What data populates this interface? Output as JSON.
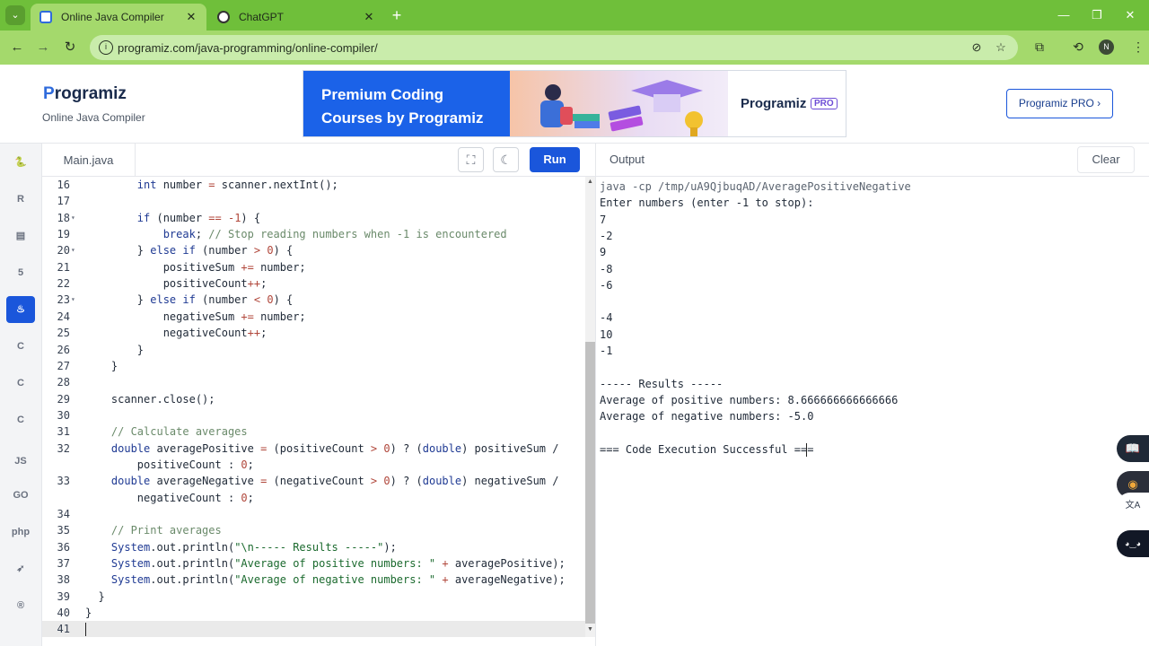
{
  "browser": {
    "tabs": [
      {
        "label": "Online Java Compiler",
        "active": true
      },
      {
        "label": "ChatGPT",
        "active": false
      }
    ],
    "tab_close": "✕",
    "new_tab": "+",
    "url": "programiz.com/java-programming/online-compiler/",
    "profile_initial": "N",
    "window_controls": {
      "minimize": "—",
      "maximize": "❐",
      "close": "✕"
    },
    "nav": {
      "back": "←",
      "forward": "→",
      "reload": "↻"
    }
  },
  "header": {
    "logo_mark": "P",
    "logo_text": "rogramiz",
    "subtitle": "Online Java Compiler",
    "banner": {
      "headline_1": "Premium Coding",
      "headline_2": "Courses by Programiz",
      "brand": "Programiz",
      "badge": "PRO"
    },
    "pro_button": "Programiz PRO ›"
  },
  "rail": [
    {
      "name": "python-icon",
      "glyph": "🐍",
      "active": false
    },
    {
      "name": "r-icon",
      "glyph": "R",
      "active": false
    },
    {
      "name": "sql-icon",
      "glyph": "▤",
      "active": false
    },
    {
      "name": "html-icon",
      "glyph": "5",
      "active": false
    },
    {
      "name": "java-icon",
      "glyph": "♨",
      "active": true
    },
    {
      "name": "c-icon",
      "glyph": "C",
      "active": false
    },
    {
      "name": "cpp-icon",
      "glyph": "C",
      "active": false
    },
    {
      "name": "csharp-icon",
      "glyph": "C",
      "active": false
    },
    {
      "name": "js-icon",
      "glyph": "JS",
      "active": false
    },
    {
      "name": "go-icon",
      "glyph": "GO",
      "active": false
    },
    {
      "name": "php-icon",
      "glyph": "php",
      "active": false
    },
    {
      "name": "swift-icon",
      "glyph": "➶",
      "active": false
    },
    {
      "name": "rust-icon",
      "glyph": "®",
      "active": false
    }
  ],
  "editor": {
    "file_tab": "Main.java",
    "run_label": "Run",
    "fullscreen_glyph": "⛶",
    "theme_glyph": "☾"
  },
  "code": [
    {
      "n": "16",
      "fold": false,
      "segs": [
        [
          "",
          "        "
        ],
        [
          "kw",
          "int"
        ],
        [
          "",
          " number "
        ],
        [
          "op",
          "="
        ],
        [
          "",
          " scanner.nextInt();"
        ]
      ]
    },
    {
      "n": "17",
      "fold": false,
      "segs": []
    },
    {
      "n": "18",
      "fold": true,
      "segs": [
        [
          "",
          "        "
        ],
        [
          "kw",
          "if"
        ],
        [
          "",
          " (number "
        ],
        [
          "op",
          "=="
        ],
        [
          "",
          " "
        ],
        [
          "op",
          "-1"
        ],
        [
          "",
          ") {"
        ]
      ]
    },
    {
      "n": "19",
      "fold": false,
      "segs": [
        [
          "",
          "            "
        ],
        [
          "kw",
          "break"
        ],
        [
          "",
          "; "
        ],
        [
          "cm",
          "// Stop reading numbers when -1 is encountered"
        ]
      ]
    },
    {
      "n": "20",
      "fold": true,
      "segs": [
        [
          "",
          "        } "
        ],
        [
          "kw",
          "else if"
        ],
        [
          "",
          " (number "
        ],
        [
          "op",
          ">"
        ],
        [
          "",
          " "
        ],
        [
          "op",
          "0"
        ],
        [
          "",
          ") {"
        ]
      ]
    },
    {
      "n": "21",
      "fold": false,
      "segs": [
        [
          "",
          "            positiveSum "
        ],
        [
          "op",
          "+="
        ],
        [
          "",
          " number;"
        ]
      ]
    },
    {
      "n": "22",
      "fold": false,
      "segs": [
        [
          "",
          "            positiveCount"
        ],
        [
          "op",
          "++"
        ],
        [
          "",
          ";"
        ]
      ]
    },
    {
      "n": "23",
      "fold": true,
      "segs": [
        [
          "",
          "        } "
        ],
        [
          "kw",
          "else if"
        ],
        [
          "",
          " (number "
        ],
        [
          "op",
          "<"
        ],
        [
          "",
          " "
        ],
        [
          "op",
          "0"
        ],
        [
          "",
          ") {"
        ]
      ]
    },
    {
      "n": "24",
      "fold": false,
      "segs": [
        [
          "",
          "            negativeSum "
        ],
        [
          "op",
          "+="
        ],
        [
          "",
          " number;"
        ]
      ]
    },
    {
      "n": "25",
      "fold": false,
      "segs": [
        [
          "",
          "            negativeCount"
        ],
        [
          "op",
          "++"
        ],
        [
          "",
          ";"
        ]
      ]
    },
    {
      "n": "26",
      "fold": false,
      "segs": [
        [
          "",
          "        }"
        ]
      ]
    },
    {
      "n": "27",
      "fold": false,
      "segs": [
        [
          "",
          "    }"
        ]
      ]
    },
    {
      "n": "28",
      "fold": false,
      "segs": []
    },
    {
      "n": "29",
      "fold": false,
      "segs": [
        [
          "",
          "    scanner.close();"
        ]
      ]
    },
    {
      "n": "30",
      "fold": false,
      "segs": []
    },
    {
      "n": "31",
      "fold": false,
      "segs": [
        [
          "",
          "    "
        ],
        [
          "cm",
          "// Calculate averages"
        ]
      ]
    },
    {
      "n": "32",
      "fold": false,
      "segs": [
        [
          "",
          "    "
        ],
        [
          "kw",
          "double"
        ],
        [
          "",
          " averagePositive "
        ],
        [
          "op",
          "="
        ],
        [
          "",
          " (positiveCount "
        ],
        [
          "op",
          ">"
        ],
        [
          "",
          " "
        ],
        [
          "op",
          "0"
        ],
        [
          "",
          ") ? ("
        ],
        [
          "kw",
          "double"
        ],
        [
          "",
          ") positiveSum /"
        ]
      ]
    },
    {
      "n": "",
      "fold": false,
      "segs": [
        [
          "",
          "        positiveCount : "
        ],
        [
          "op",
          "0"
        ],
        [
          "",
          ";"
        ]
      ]
    },
    {
      "n": "33",
      "fold": false,
      "segs": [
        [
          "",
          "    "
        ],
        [
          "kw",
          "double"
        ],
        [
          "",
          " averageNegative "
        ],
        [
          "op",
          "="
        ],
        [
          "",
          " (negativeCount "
        ],
        [
          "op",
          ">"
        ],
        [
          "",
          " "
        ],
        [
          "op",
          "0"
        ],
        [
          "",
          ") ? ("
        ],
        [
          "kw",
          "double"
        ],
        [
          "",
          ") negativeSum /"
        ]
      ]
    },
    {
      "n": "",
      "fold": false,
      "segs": [
        [
          "",
          "        negativeCount : "
        ],
        [
          "op",
          "0"
        ],
        [
          "",
          ";"
        ]
      ]
    },
    {
      "n": "34",
      "fold": false,
      "segs": []
    },
    {
      "n": "35",
      "fold": false,
      "segs": [
        [
          "",
          "    "
        ],
        [
          "cm",
          "// Print averages"
        ]
      ]
    },
    {
      "n": "36",
      "fold": false,
      "segs": [
        [
          "",
          "    "
        ],
        [
          "kw",
          "System"
        ],
        [
          "",
          ".out.println("
        ],
        [
          "str",
          "\"\\n----- Results -----\""
        ],
        [
          "",
          ");"
        ]
      ]
    },
    {
      "n": "37",
      "fold": false,
      "segs": [
        [
          "",
          "    "
        ],
        [
          "kw",
          "System"
        ],
        [
          "",
          ".out.println("
        ],
        [
          "str",
          "\"Average of positive numbers: \""
        ],
        [
          "",
          " "
        ],
        [
          "op",
          "+"
        ],
        [
          "",
          " averagePositive);"
        ]
      ]
    },
    {
      "n": "38",
      "fold": false,
      "segs": [
        [
          "",
          "    "
        ],
        [
          "kw",
          "System"
        ],
        [
          "",
          ".out.println("
        ],
        [
          "str",
          "\"Average of negative numbers: \""
        ],
        [
          "",
          " "
        ],
        [
          "op",
          "+"
        ],
        [
          "",
          " averageNegative);"
        ]
      ]
    },
    {
      "n": "39",
      "fold": false,
      "segs": [
        [
          "",
          "  }"
        ]
      ]
    },
    {
      "n": "40",
      "fold": false,
      "segs": [
        [
          "",
          "}"
        ]
      ]
    },
    {
      "n": "41",
      "fold": false,
      "segs": [],
      "current": true
    }
  ],
  "output": {
    "title": "Output",
    "clear_label": "Clear",
    "lines": [
      "java -cp /tmp/uA9QjbuqAD/AveragePositiveNegative",
      "Enter numbers (enter -1 to stop):",
      "7",
      "-2",
      "9",
      "-8",
      "-6",
      "",
      "-4",
      "10",
      "-1",
      "",
      "----- Results -----",
      "Average of positive numbers: 8.666666666666666",
      "Average of negative numbers: -5.0",
      "",
      "=== Code Execution Successful ==="
    ]
  },
  "floating": [
    {
      "name": "reader-icon",
      "glyph": "📖"
    },
    {
      "name": "palette-icon",
      "glyph": "◉"
    },
    {
      "name": "translate-icon",
      "glyph": "文A"
    },
    {
      "name": "assistant-icon",
      "glyph": "◕‿◕"
    }
  ]
}
